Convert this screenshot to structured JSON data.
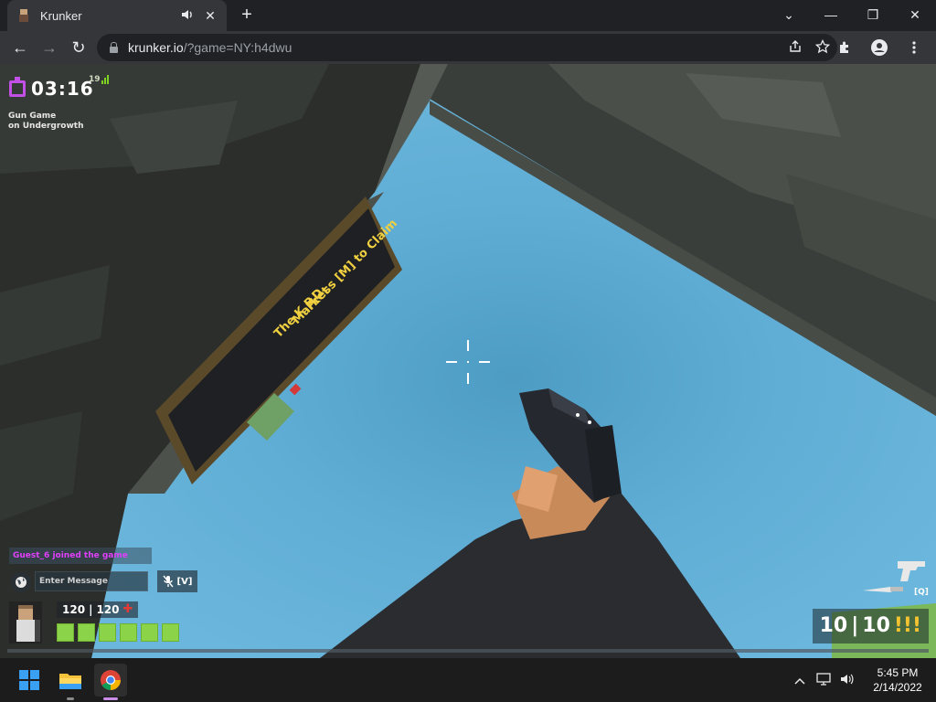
{
  "browser": {
    "tab_title": "Krunker",
    "tab_audio_icon": "speaker-icon",
    "tab_close": "✕",
    "new_tab": "+",
    "window_controls": [
      "⌄",
      "—",
      "❐",
      "✕"
    ],
    "url_host": "krunker.io",
    "url_rest": "/?game=NY:h4dwu",
    "nav": {
      "back": "←",
      "forward": "→",
      "reload": "↻"
    },
    "toolbar_icons": [
      "share-icon",
      "star-icon",
      "extensions-icon",
      "profile-icon",
      "menu-icon"
    ]
  },
  "game": {
    "timer": "03:16",
    "ping": "19",
    "mode_line1": "Gun Game",
    "mode_line2": "on Undergrowth",
    "chat_message": "Guest_6 joined the game",
    "chat_placeholder": "Enter Message",
    "voice_key": "[V]",
    "health_current": "120",
    "health_max": "120",
    "health_separator": "|",
    "armor_cells": 6,
    "ammo_current": "10",
    "ammo_max": "10",
    "ammo_separator": "|",
    "ammo_bullets": "!!!",
    "melee_key": "[Q]",
    "poster_text": [
      "Press [M] to Claim",
      "Market",
      "The K.P.D"
    ]
  },
  "taskbar": {
    "time": "5:45 PM",
    "date": "2/14/2022",
    "tray_icons": [
      "chevron-up-icon",
      "display-icon",
      "volume-icon"
    ],
    "apps": [
      "start-icon",
      "file-explorer-icon",
      "chrome-icon"
    ]
  }
}
